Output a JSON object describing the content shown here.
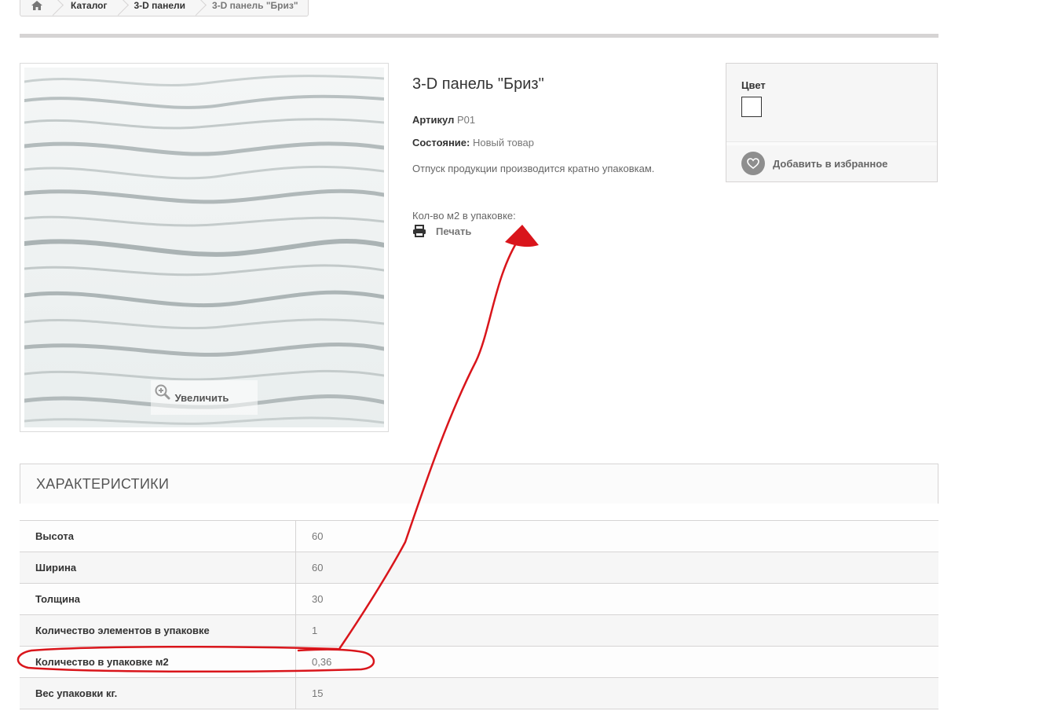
{
  "breadcrumb": {
    "home_icon": "home-icon",
    "items": [
      "Каталог",
      "3-D панели"
    ],
    "current": "3-D панель \"Бриз\""
  },
  "image": {
    "zoom_label": "Увеличить",
    "zoom_icon": "zoom-in-icon"
  },
  "product": {
    "title": "3-D панель \"Бриз\"",
    "sku_label": "Артикул",
    "sku_value": "P01",
    "condition_label": "Состояние:",
    "condition_value": "Новый товар",
    "note": "Отпуск продукции производится кратно упаковкам.",
    "pack_label": "Кол-во м2 в упаковке:",
    "print_label": "Печать",
    "print_icon": "printer-icon"
  },
  "options": {
    "color_label": "Цвет",
    "swatch_color": "#ffffff",
    "favorite_label": "Добавить в избранное",
    "favorite_icon": "heart-icon"
  },
  "characteristics": {
    "title": "ХАРАКТЕРИСТИКИ",
    "rows": [
      {
        "name": "Высота",
        "value": "60"
      },
      {
        "name": "Ширина",
        "value": "60"
      },
      {
        "name": "Толщина",
        "value": "30"
      },
      {
        "name": "Количество элементов в упаковке",
        "value": "1"
      },
      {
        "name": "Количество в упаковке м2",
        "value": "0,36"
      },
      {
        "name": "Вес упаковки кг.",
        "value": "15"
      }
    ]
  },
  "colors": {
    "annotation_red": "#d9151b",
    "accent_gray": "#d6d4d4"
  }
}
